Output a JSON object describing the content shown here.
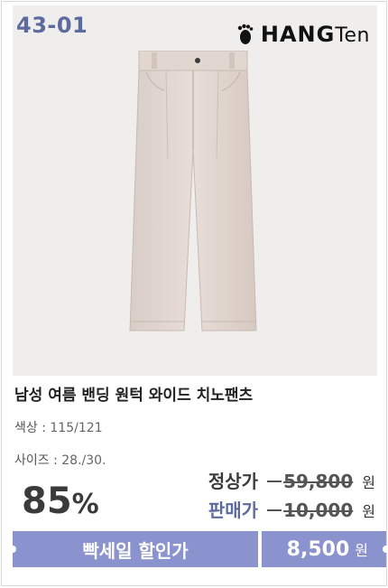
{
  "badge": {
    "code": "43-01"
  },
  "brand": {
    "logo_text_main": "HANG",
    "logo_text_small": "Ten"
  },
  "product": {
    "title": "남성 여름 밴딩 원턱 와이드 치노팬츠",
    "color_label": "색상 :",
    "color_value": "115/121",
    "size_label": "사이즈 :",
    "size_value": "28./30."
  },
  "pricing": {
    "discount_value": "85",
    "discount_symbol": "%",
    "regular_label": "정상가",
    "regular_price": "59,800",
    "sale_label": "판매가",
    "sale_price": "10,000",
    "currency": "원",
    "flash_sale_label": "빡세일 할인가",
    "flash_sale_price": "8,500",
    "colors": {
      "regular_label": "#3b3b3b",
      "sale_label": "#5d6aa0",
      "bar": "#8b93cf"
    }
  }
}
